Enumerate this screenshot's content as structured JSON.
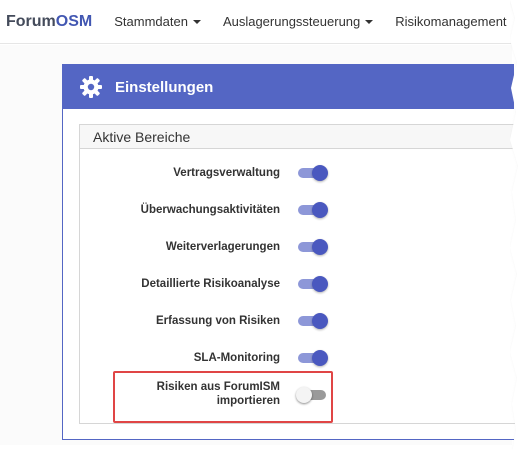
{
  "navbar": {
    "brand_prefix": "Forum",
    "brand_suffix": "OSM",
    "items": [
      {
        "label": "Stammdaten",
        "dropdown": true
      },
      {
        "label": "Auslagerungssteuerung",
        "dropdown": true
      },
      {
        "label": "Risikomanagement",
        "dropdown": false
      }
    ]
  },
  "card": {
    "title": "Einstellungen",
    "icon": "gear-icon",
    "header_color": "#5466c4"
  },
  "section": {
    "legend": "Aktive Bereiche",
    "settings": [
      {
        "label": "Vertragsverwaltung",
        "enabled": true
      },
      {
        "label": "Überwachungsaktivitäten",
        "enabled": true
      },
      {
        "label": "Weiterverlagerungen",
        "enabled": true
      },
      {
        "label": "Detaillierte Risikoanalyse",
        "enabled": true
      },
      {
        "label": "Erfassung von Risiken",
        "enabled": true
      },
      {
        "label": "SLA-Monitoring",
        "enabled": true
      },
      {
        "label_line1": "Risiken aus ForumISM",
        "label_line2": "importieren",
        "enabled": false,
        "highlighted": true
      }
    ]
  },
  "colors": {
    "accent": "#5466c4",
    "toggle_on": "#4a58bf",
    "highlight_border": "#e04545"
  }
}
